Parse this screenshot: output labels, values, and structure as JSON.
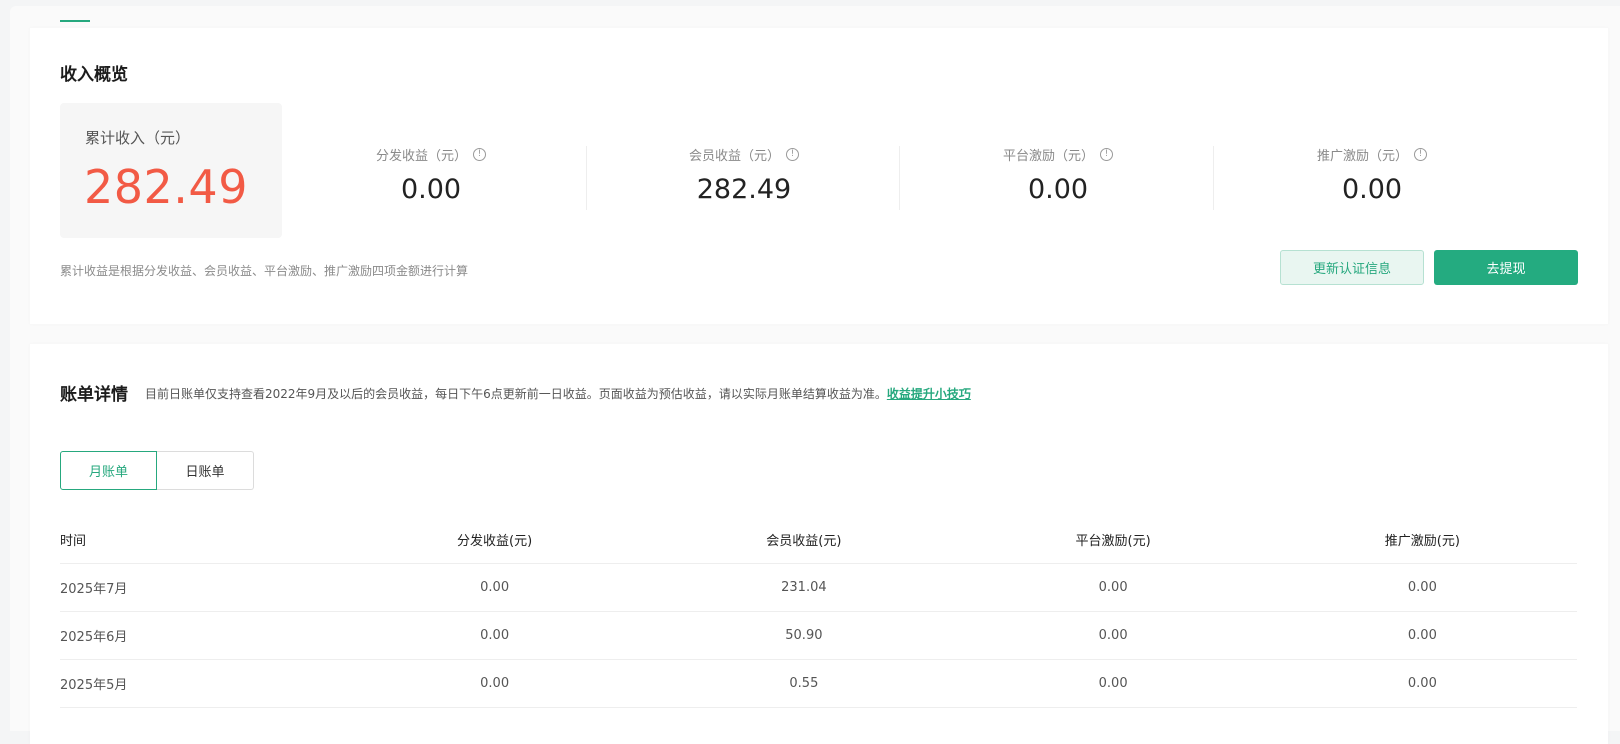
{
  "income_overview": {
    "title": "收入概览",
    "total": {
      "label": "累计收入（元）",
      "value": "282.49"
    },
    "metrics": [
      {
        "label": "分发收益（元）",
        "value": "0.00"
      },
      {
        "label": "会员收益（元）",
        "value": "282.49"
      },
      {
        "label": "平台激励（元）",
        "value": "0.00"
      },
      {
        "label": "推广激励（元）",
        "value": "0.00"
      }
    ],
    "info_glyph": "!",
    "hint": "累计收益是根据分发收益、会员收益、平台激励、推广激励四项金额进行计算",
    "update_button": "更新认证信息",
    "withdraw_button": "去提现"
  },
  "bill_details": {
    "title": "账单详情",
    "description": "目前日账单仅支持查看2022年9月及以后的会员收益，每日下午6点更新前一日收益。页面收益为预估收益，请以实际月账单结算收益为准。",
    "tips_link": "收益提升小技巧",
    "tabs": [
      {
        "label": "月账单",
        "active": true
      },
      {
        "label": "日账单",
        "active": false
      }
    ],
    "table": {
      "columns": [
        "时间",
        "分发收益(元)",
        "会员收益(元)",
        "平台激励(元)",
        "推广激励(元)"
      ],
      "rows": [
        [
          "2025年7月",
          "0.00",
          "231.04",
          "0.00",
          "0.00"
        ],
        [
          "2025年6月",
          "0.00",
          "50.90",
          "0.00",
          "0.00"
        ],
        [
          "2025年5月",
          "0.00",
          "0.55",
          "0.00",
          "0.00"
        ]
      ]
    }
  },
  "colors": {
    "accent": "#26a87e",
    "total_value": "#f25a45"
  }
}
